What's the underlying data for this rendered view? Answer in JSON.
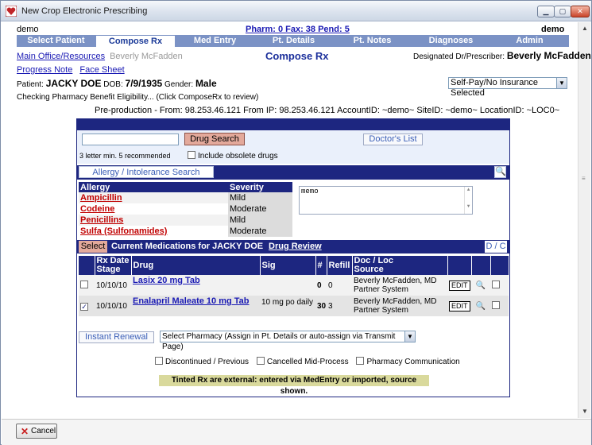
{
  "window": {
    "title": "New Crop Electronic Prescribing"
  },
  "header": {
    "user_left": "demo",
    "counts": "Pharm: 0  Fax: 38  Pend: 5",
    "user_right": "demo"
  },
  "tabs": [
    {
      "label": "Select Patient"
    },
    {
      "label": "Compose Rx"
    },
    {
      "label": "Med Entry"
    },
    {
      "label": "Pt. Details"
    },
    {
      "label": "Pt. Notes"
    },
    {
      "label": "Diagnoses"
    },
    {
      "label": "Admin"
    }
  ],
  "nav": {
    "main_office": "Main Office/Resources",
    "doctor_name": "Beverly McFadden",
    "page_title": "Compose Rx",
    "prescriber_label": "Designated Dr/Prescriber:",
    "prescriber_name": "Beverly McFadden",
    "progress_note": "Progress Note",
    "face_sheet": "Face Sheet"
  },
  "patient": {
    "label": "Patient:",
    "name": "JACKY DOE",
    "dob_label": "DOB:",
    "dob": "7/9/1935",
    "gender_label": "Gender:",
    "gender": "Male",
    "insurance": "Self-Pay/No Insurance Selected"
  },
  "eligibility": "Checking Pharmacy Benefit Eligibility... (Click ComposeRx to review)",
  "preprod": "Pre-production - From: 98.253.46.121 From IP: 98.253.46.121 AccountID: ~demo~ SiteID: ~demo~ LocationID: ~LOC0~",
  "search": {
    "drug_search_label": "Drug Search",
    "doctors_list_label": "Doctor's List",
    "hint": "3 letter min. 5 recommended",
    "obsolete_label": "Include obsolete drugs"
  },
  "allergy": {
    "search_label": "Allergy / Intolerance Search",
    "col_allergy": "Allergy",
    "col_severity": "Severity",
    "rows": [
      {
        "name": "Ampicillin",
        "severity": "Mild"
      },
      {
        "name": "Codeine",
        "severity": "Moderate"
      },
      {
        "name": "Penicillins",
        "severity": "Mild"
      },
      {
        "name": "Sulfa (Sulfonamides)",
        "severity": "Moderate"
      }
    ],
    "memo": "memo"
  },
  "meds": {
    "select_label": "Select",
    "title": "Current Medications for JACKY DOE",
    "drug_review": "Drug Review",
    "dc_label": "D / C",
    "columns": {
      "rx_date": "Rx Date",
      "stage": "Stage",
      "drug": "Drug",
      "sig": "Sig",
      "num": "#",
      "refill": "Refill",
      "doc_loc": "Doc / Loc",
      "source": "Source"
    },
    "rows": [
      {
        "date": "10/10/10",
        "drug": "Lasix 20 mg Tab",
        "sig": "",
        "qty": "0",
        "refill": "0",
        "doc": "Beverly McFadden, MD",
        "loc": "Partner System",
        "edit": "EDIT",
        "checked": false
      },
      {
        "date": "10/10/10",
        "drug": "Enalapril Maleate 10 mg Tab",
        "sig": "10 mg po daily",
        "qty": "30",
        "refill": "3",
        "doc": "Beverly McFadden, MD",
        "loc": "Partner System",
        "edit": "EDIT",
        "checked": true
      }
    ]
  },
  "pharmacy": {
    "instant_renewal": "Instant Renewal",
    "select_pharmacy": "Select Pharmacy (Assign in Pt. Details or auto-assign via Transmit Page)"
  },
  "filters": {
    "discontinued": "Discontinued / Previous",
    "cancelled": "Cancelled Mid-Process",
    "pharmacy_comm": "Pharmacy Communication"
  },
  "tinted_note": "Tinted Rx are external: entered via MedEntry or imported, source shown.",
  "footer": {
    "cancel_label": "Cancel"
  },
  "colors": {
    "navy": "#1d2680",
    "tab_blue": "#7b92c5",
    "drug_search": "#e3a99b",
    "tinted": "#d9d99c",
    "allergy_red": "#c00000"
  }
}
